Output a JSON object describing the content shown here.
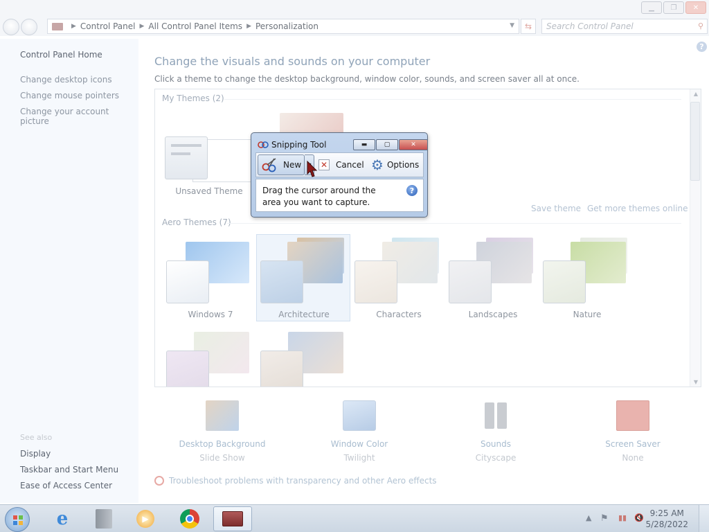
{
  "window": {
    "breadcrumb": [
      "Control Panel",
      "All Control Panel Items",
      "Personalization"
    ],
    "search_placeholder": "Search Control Panel",
    "caption_buttons": [
      "minimize",
      "maximize",
      "close"
    ]
  },
  "sidebar": {
    "home": "Control Panel Home",
    "links": [
      "Change desktop icons",
      "Change mouse pointers",
      "Change your account picture"
    ],
    "see_also_label": "See also",
    "see_also": [
      "Display",
      "Taskbar and Start Menu",
      "Ease of Access Center"
    ]
  },
  "main": {
    "title": "Change the visuals and sounds on your computer",
    "subtitle": "Click a theme to change the desktop background, window color, sounds, and screen saver all at once.",
    "my_themes_label": "My Themes (2)",
    "unsaved_theme": "Unsaved Theme",
    "save_theme": "Save theme",
    "get_more_themes": "Get more themes online",
    "aero_themes_label": "Aero Themes (7)",
    "aero_themes": [
      {
        "name": "Windows 7",
        "selected": false
      },
      {
        "name": "Architecture",
        "selected": true
      },
      {
        "name": "Characters",
        "selected": false
      },
      {
        "name": "Landscapes",
        "selected": false
      },
      {
        "name": "Nature",
        "selected": false
      }
    ],
    "bottom": [
      {
        "label": "Desktop Background",
        "sub": "Slide Show",
        "icon": "desktop-background-icon"
      },
      {
        "label": "Window Color",
        "sub": "Twilight",
        "icon": "window-color-icon"
      },
      {
        "label": "Sounds",
        "sub": "Cityscape",
        "icon": "sounds-icon"
      },
      {
        "label": "Screen Saver",
        "sub": "None",
        "icon": "screen-saver-icon"
      }
    ],
    "troubleshoot": "Troubleshoot problems with transparency and other Aero effects"
  },
  "snipping_tool": {
    "title": "Snipping Tool",
    "new": "New",
    "cancel": "Cancel",
    "options": "Options",
    "instruction": "Drag the cursor around the area you want to capture."
  },
  "taskbar": {
    "time": "9:25 AM",
    "date": "5/28/2022",
    "pinned": [
      "internet-explorer-icon",
      "libraries-icon",
      "media-player-icon",
      "chrome-icon",
      "snipping-tool-icon"
    ]
  },
  "colors": {
    "accent": "#2a5fb8",
    "snip_frame": "#b5cbe7",
    "close_red": "#c75050"
  }
}
